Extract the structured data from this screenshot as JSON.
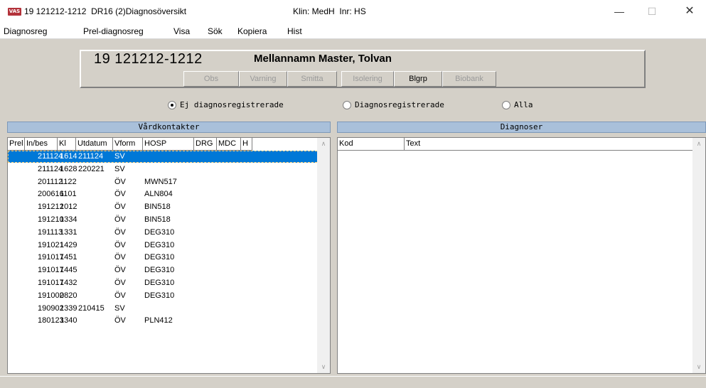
{
  "titlebar": {
    "app_icon": "VAS",
    "title": "19 121212-1212  DR16 (2)Diagnosöversikt",
    "klin": "Klin: MedH  Inr: HS",
    "minimize": "—",
    "maximize": "☐",
    "close": "✕"
  },
  "menu": [
    "Diagnosreg",
    "Prel-diagnosreg",
    "Visa",
    "Sök",
    "Kopiera",
    "Hist"
  ],
  "patient": {
    "pnr": "19 121212-1212",
    "name": "Mellannamn Master, Tolvan",
    "flags": [
      {
        "label": "Obs",
        "active": false
      },
      {
        "label": "Varning",
        "active": false
      },
      {
        "label": "Smitta",
        "active": false
      },
      {
        "label": "Isolering",
        "active": false
      },
      {
        "label": "Blgrp",
        "active": true
      },
      {
        "label": "Biobank",
        "active": false
      }
    ]
  },
  "filter": {
    "options": [
      "Ej diagnosregistrerade",
      "Diagnosregistrerade",
      "Alla"
    ],
    "selected": "Ej diagnosregistrerade"
  },
  "vardkontakter": {
    "title": "Vårdkontakter",
    "columns": [
      "Prel",
      "In/bes",
      "Kl",
      "Utdatum",
      "Vform",
      "HOSP",
      "DRG",
      "MDC",
      "H"
    ],
    "rows": [
      {
        "prel": "",
        "inbes": "211124",
        "kl": "1614",
        "utdatum": "211124",
        "vform": "SV",
        "hosp": "",
        "selected": true
      },
      {
        "prel": "",
        "inbes": "211124",
        "kl": "1628",
        "utdatum": "220221",
        "vform": "SV",
        "hosp": ""
      },
      {
        "prel": "",
        "inbes": "201112",
        "kl": "1122",
        "utdatum": "",
        "vform": "ÖV",
        "hosp": "MWN517"
      },
      {
        "prel": "",
        "inbes": "200616",
        "kl": "1101",
        "utdatum": "",
        "vform": "ÖV",
        "hosp": "ALN804"
      },
      {
        "prel": "",
        "inbes": "191212",
        "kl": "1012",
        "utdatum": "",
        "vform": "ÖV",
        "hosp": "BIN518"
      },
      {
        "prel": "",
        "inbes": "191210",
        "kl": "1334",
        "utdatum": "",
        "vform": "ÖV",
        "hosp": "BIN518"
      },
      {
        "prel": "",
        "inbes": "191113",
        "kl": "1331",
        "utdatum": "",
        "vform": "ÖV",
        "hosp": "DEG310"
      },
      {
        "prel": "",
        "inbes": "191021",
        "kl": "1429",
        "utdatum": "",
        "vform": "ÖV",
        "hosp": "DEG310"
      },
      {
        "prel": "",
        "inbes": "191017",
        "kl": "1451",
        "utdatum": "",
        "vform": "ÖV",
        "hosp": "DEG310"
      },
      {
        "prel": "",
        "inbes": "191017",
        "kl": "1445",
        "utdatum": "",
        "vform": "ÖV",
        "hosp": "DEG310"
      },
      {
        "prel": "",
        "inbes": "191017",
        "kl": "1432",
        "utdatum": "",
        "vform": "ÖV",
        "hosp": "DEG310"
      },
      {
        "prel": "",
        "inbes": "191002",
        "kl": "0820",
        "utdatum": "",
        "vform": "ÖV",
        "hosp": "DEG310"
      },
      {
        "prel": "",
        "inbes": "190902",
        "kl": "1339",
        "utdatum": "210415",
        "vform": "SV",
        "hosp": ""
      },
      {
        "prel": "",
        "inbes": "180123",
        "kl": "1340",
        "utdatum": "",
        "vform": "ÖV",
        "hosp": "PLN412"
      }
    ]
  },
  "diagnoser": {
    "title": "Diagnoser",
    "columns": [
      "Kod",
      "Text"
    ]
  },
  "colors": {
    "selection": "#0078d7",
    "panel_title_bg": "#a9c0da",
    "window_bg": "#d4d0c8",
    "app_icon": "#b3323a"
  }
}
